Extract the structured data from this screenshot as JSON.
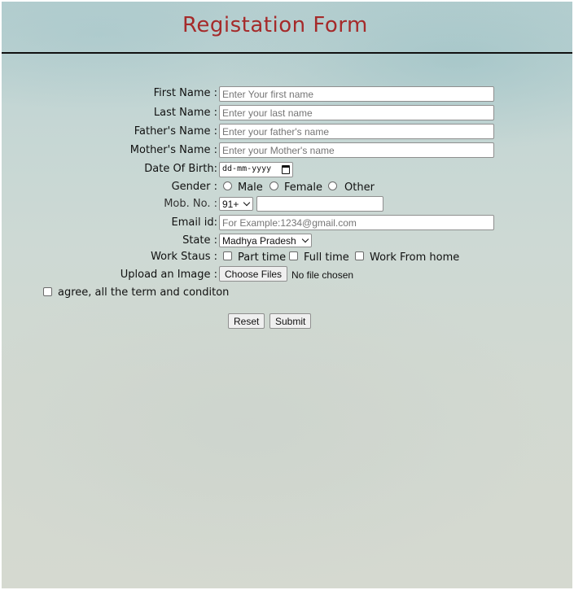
{
  "form": {
    "title": "Registation Form",
    "first_name": {
      "label": "First Name :",
      "placeholder": "Enter Your first name"
    },
    "last_name": {
      "label": "Last Name :",
      "placeholder": "Enter your last name"
    },
    "father_name": {
      "label": "Father's Name :",
      "placeholder": "Enter your father's name"
    },
    "mother_name": {
      "label": "Mother's Name :",
      "placeholder": "Enter your Mother's name"
    },
    "dob": {
      "label": "Date Of Birth:",
      "value": "dd-mm-yyyy"
    },
    "gender": {
      "label": "Gender :",
      "options": [
        "Male",
        "Female",
        "Other"
      ]
    },
    "mobile": {
      "label": "Mob. No. :",
      "code": "91+",
      "value": ""
    },
    "email": {
      "label": "Email id:",
      "placeholder": "For Example:1234@gmail.com"
    },
    "state": {
      "label": "State :",
      "selected": "Madhya Pradesh"
    },
    "work_status": {
      "label": "Work Staus :",
      "options": [
        "Part time",
        "Full time",
        "Work From home"
      ]
    },
    "upload": {
      "label": "Upload an Image :",
      "button": "Choose Files",
      "status": "No file chosen"
    },
    "agree": {
      "label": "agree, all the term and conditon"
    },
    "reset_label": "Reset",
    "submit_label": "Submit"
  }
}
